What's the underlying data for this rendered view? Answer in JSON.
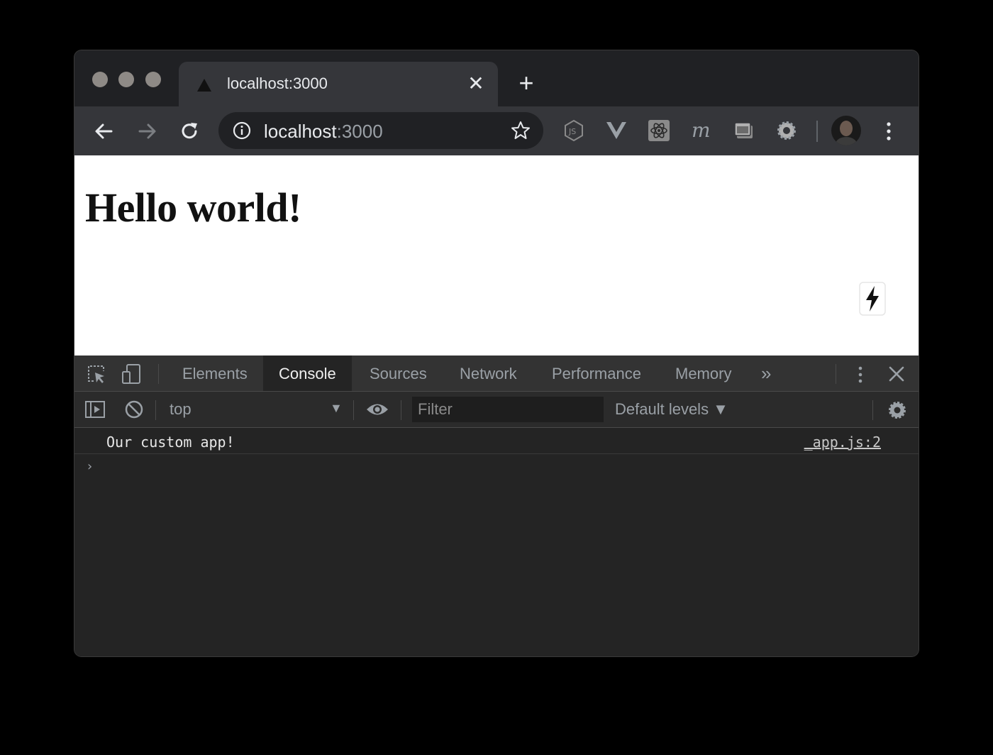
{
  "browser": {
    "tab": {
      "title": "localhost:3000"
    },
    "omnibox": {
      "host": "localhost",
      "port": ":3000"
    },
    "extensions": [
      "nodejs-icon",
      "vue-devtools-icon",
      "react-devtools-icon",
      "mercury-icon",
      "window-icon",
      "settings-gear-icon"
    ]
  },
  "page": {
    "heading": "Hello world!"
  },
  "devtools": {
    "tabs": [
      {
        "label": "Elements"
      },
      {
        "label": "Console"
      },
      {
        "label": "Sources"
      },
      {
        "label": "Network"
      },
      {
        "label": "Performance"
      },
      {
        "label": "Memory"
      }
    ],
    "active_tab": "Console",
    "more_label": "»",
    "console_toolbar": {
      "context": "top",
      "filter_placeholder": "Filter",
      "levels": "Default levels ▼"
    },
    "messages": [
      {
        "text": "Our custom app!",
        "source": "_app.js:2"
      }
    ],
    "prompt": "›"
  }
}
